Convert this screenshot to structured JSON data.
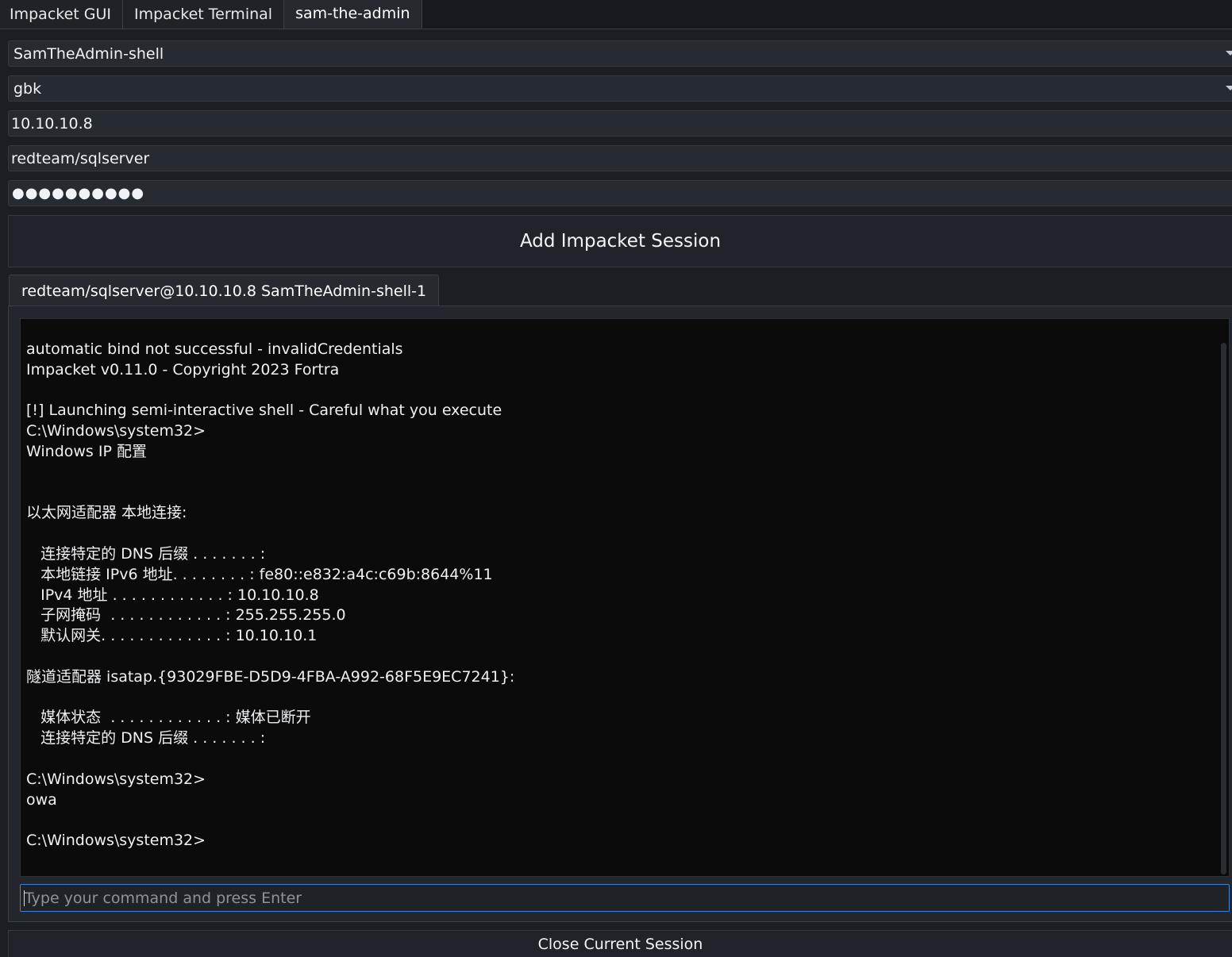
{
  "tabs": [
    {
      "label": "Impacket GUI",
      "active": false
    },
    {
      "label": "Impacket Terminal",
      "active": false
    },
    {
      "label": "sam-the-admin",
      "active": true
    }
  ],
  "form": {
    "module_select": "SamTheAdmin-shell",
    "encoding_select": "gbk",
    "target_ip": "10.10.10.8",
    "username": "redteam/sqlserver",
    "password_masked": "●●●●●●●●●●",
    "add_button_label": "Add Impacket Session"
  },
  "session": {
    "tab_label": "redteam/sqlserver@10.10.10.8 SamTheAdmin-shell-1",
    "terminal_lines": [
      "automatic bind not successful - invalidCredentials",
      "Impacket v0.11.0 - Copyright 2023 Fortra",
      "",
      "[!] Launching semi-interactive shell - Careful what you execute",
      "C:\\Windows\\system32>",
      "Windows IP 配置",
      "",
      "",
      "以太网适配器 本地连接:",
      "",
      "   连接特定的 DNS 后缀 . . . . . . . :",
      "   本地链接 IPv6 地址. . . . . . . . : fe80::e832:a4c:c69b:8644%11",
      "   IPv4 地址 . . . . . . . . . . . . : 10.10.10.8",
      "   子网掩码  . . . . . . . . . . . . : 255.255.255.0",
      "   默认网关. . . . . . . . . . . . . : 10.10.10.1",
      "",
      "隧道适配器 isatap.{93029FBE-D5D9-4FBA-A992-68F5E9EC7241}:",
      "",
      "   媒体状态  . . . . . . . . . . . . : 媒体已断开",
      "   连接特定的 DNS 后缀 . . . . . . . :",
      "",
      "C:\\Windows\\system32>",
      "owa",
      "",
      "C:\\Windows\\system32>"
    ],
    "command_placeholder": "Type your command and press Enter",
    "close_button_label": "Close Current Session"
  },
  "colors": {
    "background": "#1b1e23",
    "terminal_bg": "#0b0b0c",
    "input_focus_border": "#3d7fd9"
  }
}
